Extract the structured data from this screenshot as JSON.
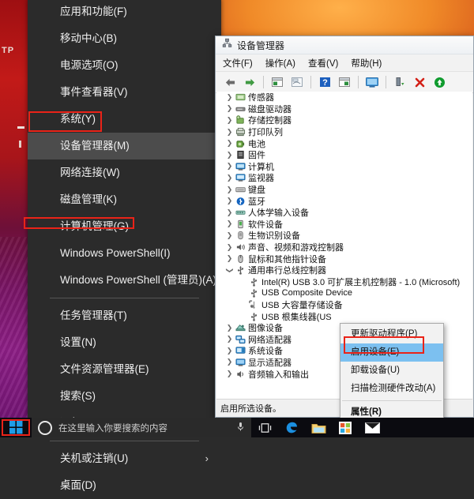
{
  "desktop": {
    "wallpaper_name": "canyon-wallpaper",
    "left_text": "TP",
    "colors": {
      "accent_red": "#ea2318",
      "wall_orange": "#e0661d",
      "wall_purple": "#8d1f86"
    }
  },
  "winx_menu": {
    "name": "power-user-menu",
    "items": [
      {
        "label": "应用和功能(F)",
        "selected": false,
        "submenu": false
      },
      {
        "label": "移动中心(B)",
        "selected": false,
        "submenu": false
      },
      {
        "label": "电源选项(O)",
        "selected": false,
        "submenu": false
      },
      {
        "label": "事件查看器(V)",
        "selected": false,
        "submenu": false
      },
      {
        "label": "系统(Y)",
        "selected": false,
        "submenu": false
      },
      {
        "label": "设备管理器(M)",
        "selected": true,
        "submenu": false
      },
      {
        "label": "网络连接(W)",
        "selected": false,
        "submenu": false
      },
      {
        "label": "磁盘管理(K)",
        "selected": false,
        "submenu": false
      },
      {
        "label": "计算机管理(G)",
        "selected": false,
        "submenu": false
      },
      {
        "label": "Windows PowerShell(I)",
        "selected": false,
        "submenu": false
      },
      {
        "label": "Windows PowerShell (管理员)(A)",
        "selected": false,
        "submenu": false
      },
      {
        "separator": true
      },
      {
        "label": "任务管理器(T)",
        "selected": false,
        "submenu": false
      },
      {
        "label": "设置(N)",
        "selected": false,
        "submenu": false
      },
      {
        "label": "文件资源管理器(E)",
        "selected": false,
        "submenu": false
      },
      {
        "label": "搜索(S)",
        "selected": false,
        "submenu": false
      },
      {
        "label": "运行(R)",
        "selected": false,
        "submenu": false
      },
      {
        "separator": true
      },
      {
        "label": "关机或注销(U)",
        "selected": false,
        "submenu": true
      },
      {
        "label": "桌面(D)",
        "selected": false,
        "submenu": false
      }
    ]
  },
  "device_manager": {
    "title": "设备管理器",
    "menubar": [
      "文件(F)",
      "操作(A)",
      "查看(V)",
      "帮助(H)"
    ],
    "toolbar": [
      {
        "name": "back-icon",
        "glyph": "back"
      },
      {
        "name": "forward-icon",
        "glyph": "forward"
      },
      {
        "name": "properties-icon",
        "glyph": "properties"
      },
      {
        "name": "print-icon",
        "glyph": "print"
      },
      {
        "name": "help-icon",
        "glyph": "help"
      },
      {
        "name": "update-driver-icon",
        "glyph": "update"
      },
      {
        "name": "scan-hardware-icon",
        "glyph": "scan"
      },
      {
        "name": "disable-device-icon",
        "glyph": "disable"
      },
      {
        "name": "uninstall-device-icon",
        "glyph": "uninstall"
      },
      {
        "name": "enable-device-icon",
        "glyph": "enable"
      }
    ],
    "status": "启用所选设备。",
    "tree": [
      {
        "label": "传感器",
        "level": 1,
        "twisty": "collapsed",
        "icon": "sensor-icon"
      },
      {
        "label": "磁盘驱动器",
        "level": 1,
        "twisty": "collapsed",
        "icon": "disk-icon"
      },
      {
        "label": "存储控制器",
        "level": 1,
        "twisty": "collapsed",
        "icon": "storage-icon"
      },
      {
        "label": "打印队列",
        "level": 1,
        "twisty": "collapsed",
        "icon": "printer-icon"
      },
      {
        "label": "电池",
        "level": 1,
        "twisty": "collapsed",
        "icon": "battery-icon"
      },
      {
        "label": "固件",
        "level": 1,
        "twisty": "collapsed",
        "icon": "firmware-icon"
      },
      {
        "label": "计算机",
        "level": 1,
        "twisty": "collapsed",
        "icon": "computer-icon"
      },
      {
        "label": "监视器",
        "level": 1,
        "twisty": "collapsed",
        "icon": "monitor-icon"
      },
      {
        "label": "键盘",
        "level": 1,
        "twisty": "collapsed",
        "icon": "keyboard-icon"
      },
      {
        "label": "蓝牙",
        "level": 1,
        "twisty": "collapsed",
        "icon": "bluetooth-icon"
      },
      {
        "label": "人体学输入设备",
        "level": 1,
        "twisty": "collapsed",
        "icon": "hid-icon"
      },
      {
        "label": "软件设备",
        "level": 1,
        "twisty": "collapsed",
        "icon": "software-icon"
      },
      {
        "label": "生物识别设备",
        "level": 1,
        "twisty": "collapsed",
        "icon": "biometric-icon"
      },
      {
        "label": "声音、视频和游戏控制器",
        "level": 1,
        "twisty": "collapsed",
        "icon": "sound-icon"
      },
      {
        "label": "鼠标和其他指针设备",
        "level": 1,
        "twisty": "collapsed",
        "icon": "mouse-icon"
      },
      {
        "label": "通用串行总线控制器",
        "level": 1,
        "twisty": "expanded",
        "icon": "usb-icon"
      },
      {
        "label": "Intel(R) USB 3.0 可扩展主机控制器 - 1.0 (Microsoft)",
        "level": 2,
        "twisty": "none",
        "icon": "usb-icon"
      },
      {
        "label": "USB Composite Device",
        "level": 2,
        "twisty": "none",
        "icon": "usb-icon"
      },
      {
        "label": "USB 大容量存储设备",
        "level": 2,
        "twisty": "none",
        "icon": "usb-disabled-icon",
        "highlighted": true
      },
      {
        "label": "USB 根集线器(US",
        "level": 2,
        "twisty": "none",
        "icon": "usb-icon"
      },
      {
        "label": "图像设备",
        "level": 1,
        "twisty": "collapsed",
        "icon": "imaging-icon"
      },
      {
        "label": "网络适配器",
        "level": 1,
        "twisty": "collapsed",
        "icon": "network-icon"
      },
      {
        "label": "系统设备",
        "level": 1,
        "twisty": "collapsed",
        "icon": "system-icon"
      },
      {
        "label": "显示适配器",
        "level": 1,
        "twisty": "collapsed",
        "icon": "display-icon"
      },
      {
        "label": "音频输入和输出",
        "level": 1,
        "twisty": "collapsed",
        "icon": "audio-icon"
      }
    ]
  },
  "context_menu": {
    "name": "device-context-menu",
    "items": [
      {
        "label": "更新驱动程序(P)",
        "selected": false,
        "bold": false
      },
      {
        "label": "启用设备(E)",
        "selected": true,
        "bold": false
      },
      {
        "label": "卸载设备(U)",
        "selected": false,
        "bold": false
      },
      {
        "label": "扫描检测硬件改动(A)",
        "selected": false,
        "bold": false
      },
      {
        "separator": true
      },
      {
        "label": "属性(R)",
        "selected": false,
        "bold": true
      }
    ]
  },
  "taskbar": {
    "start_label": "start-button",
    "search_placeholder": "在这里输入你要搜索的内容",
    "icons": [
      {
        "name": "microphone-icon"
      },
      {
        "name": "task-view-icon"
      },
      {
        "name": "edge-browser-icon"
      },
      {
        "name": "file-explorer-icon"
      },
      {
        "name": "microsoft-store-icon"
      },
      {
        "name": "mail-icon"
      }
    ]
  }
}
